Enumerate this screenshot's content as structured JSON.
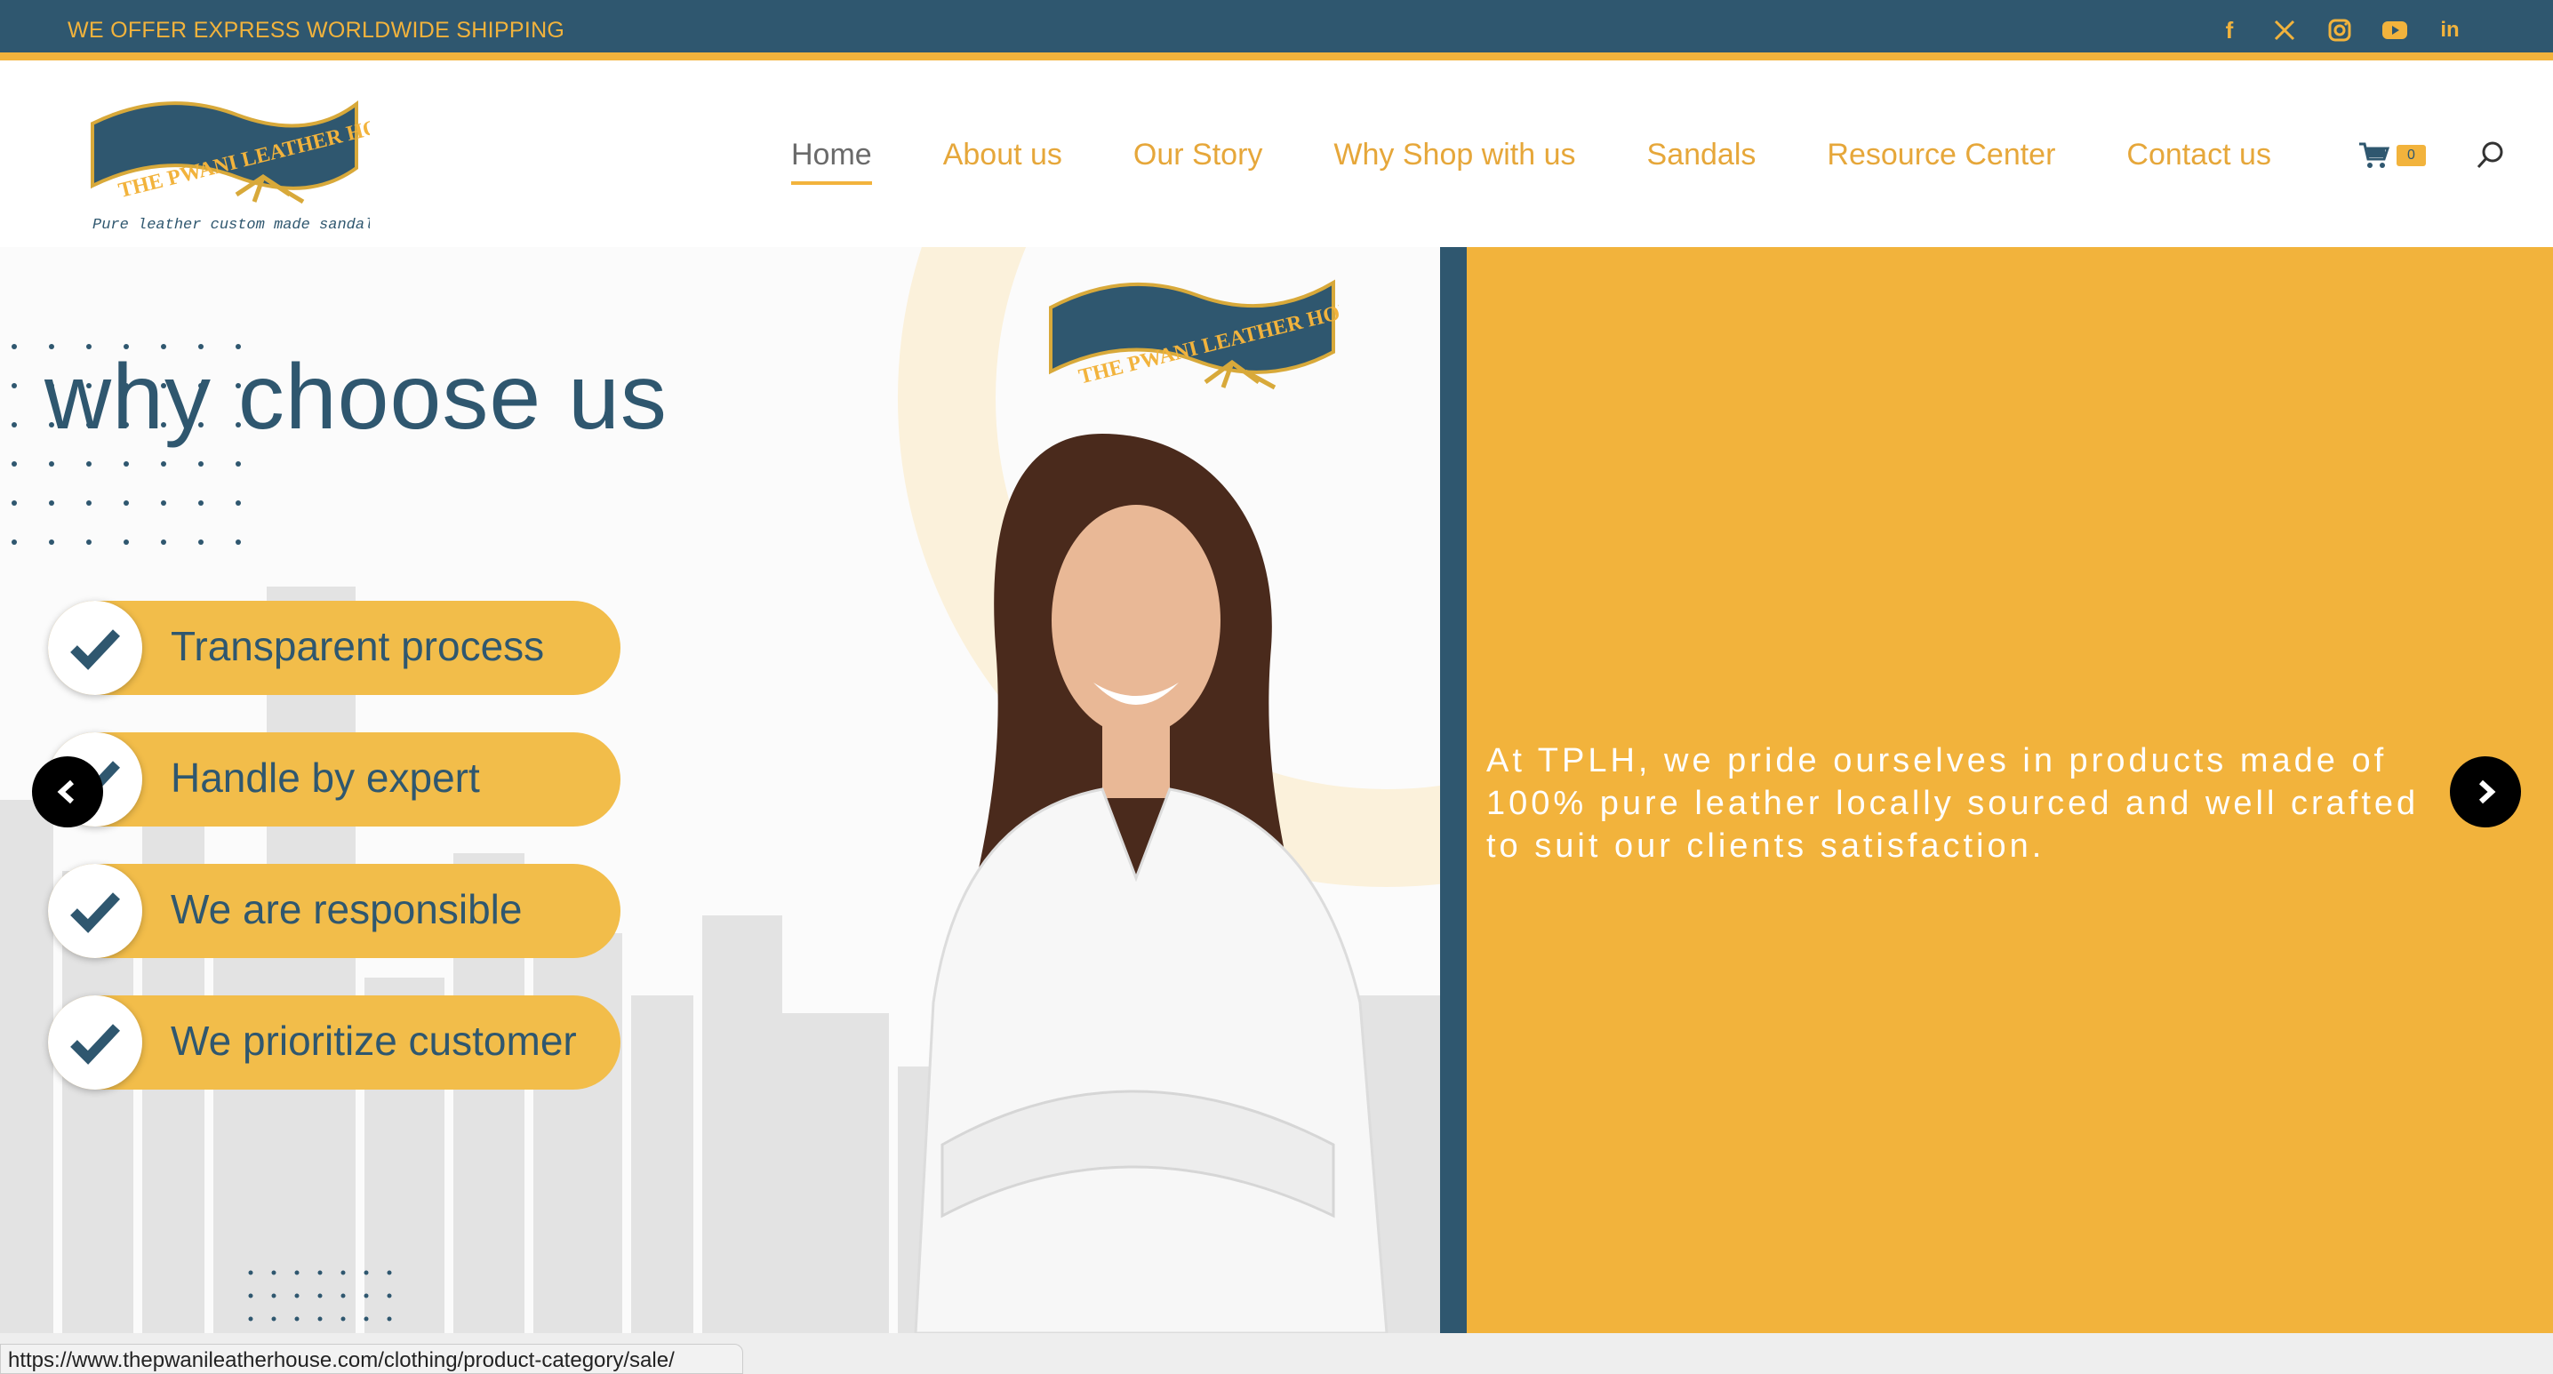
{
  "topbar": {
    "shipping_text": "WE OFFER EXPRESS WORLDWIDE SHIPPING",
    "social": [
      "facebook-icon",
      "x-icon",
      "instagram-icon",
      "youtube-icon",
      "linkedin-icon"
    ]
  },
  "header": {
    "logo_title": "THE PWANI LEATHER HOUSE",
    "logo_tagline": "Pure leather custom made sandals",
    "nav": [
      {
        "label": "Home"
      },
      {
        "label": "About us"
      },
      {
        "label": "Our Story"
      },
      {
        "label": "Why Shop with us"
      },
      {
        "label": "Sandals"
      },
      {
        "label": "Resource Center"
      },
      {
        "label": "Contact us"
      }
    ],
    "cart_count": "0"
  },
  "slide": {
    "heading": "why choose us",
    "logo_title": "THE PWANI LEATHER HOUSE",
    "items": [
      {
        "label": "Transparent process"
      },
      {
        "label": "Handle by expert"
      },
      {
        "label": "We are responsible"
      },
      {
        "label": "We prioritize customer"
      }
    ],
    "quote": "At TPLH, we pride ourselves in products made of 100% pure leather locally sourced and well crafted to suit our clients satisfaction."
  },
  "statusbar": {
    "url": "https://www.thepwanileatherhouse.com/clothing/product-category/sale/"
  },
  "colors": {
    "navy": "#2f576f",
    "gold": "#f2b33c"
  }
}
